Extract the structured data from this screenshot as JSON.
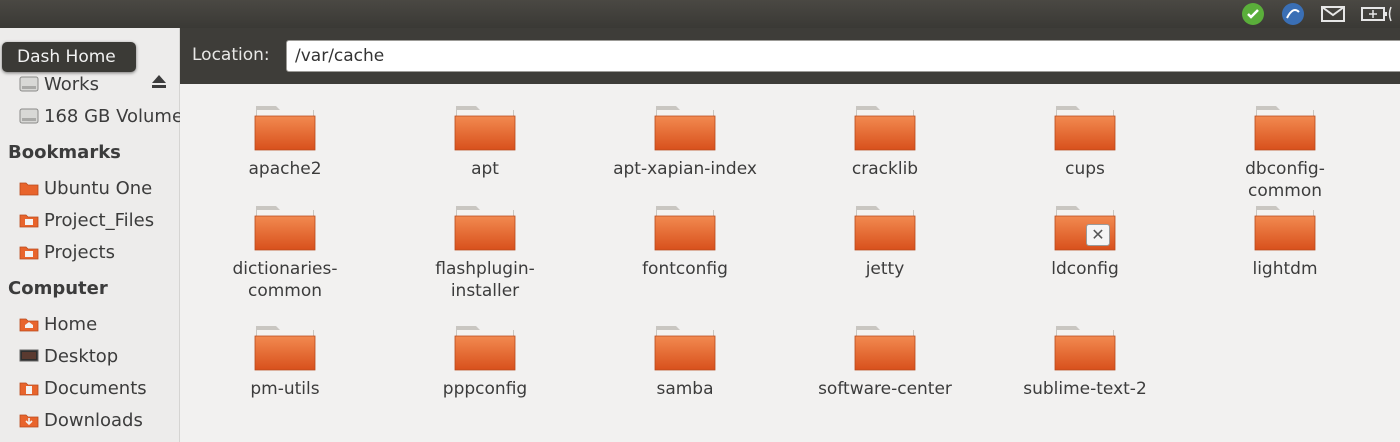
{
  "sidebar": {
    "tooltip": "Dash Home",
    "devices": [
      {
        "label": "Works",
        "icon": "drive-icon"
      },
      {
        "label": "168 GB Volume",
        "icon": "drive-icon"
      }
    ],
    "bookmarks_heading": "Bookmarks",
    "bookmarks": [
      {
        "label": "Ubuntu One",
        "icon": "folder-icon"
      },
      {
        "label": "Project_Files",
        "icon": "folder-icon"
      },
      {
        "label": "Projects",
        "icon": "folder-icon"
      }
    ],
    "computer_heading": "Computer",
    "computer": [
      {
        "label": "Home",
        "icon": "home-folder-icon"
      },
      {
        "label": "Desktop",
        "icon": "desktop-icon"
      },
      {
        "label": "Documents",
        "icon": "documents-icon"
      },
      {
        "label": "Downloads",
        "icon": "downloads-icon"
      }
    ]
  },
  "location": {
    "label": "Location:",
    "value": "/var/cache"
  },
  "folders": [
    {
      "name": "apache2"
    },
    {
      "name": "apt"
    },
    {
      "name": "apt-xapian-index"
    },
    {
      "name": "cracklib"
    },
    {
      "name": "cups"
    },
    {
      "name": "dbconfig-common"
    },
    {
      "name": "dictionaries-common"
    },
    {
      "name": "flashplugin-installer"
    },
    {
      "name": "fontconfig"
    },
    {
      "name": "jetty"
    },
    {
      "name": "ldconfig",
      "locked": true
    },
    {
      "name": "lightdm"
    },
    {
      "name": "pm-utils"
    },
    {
      "name": "pppconfig"
    },
    {
      "name": "samba"
    },
    {
      "name": "software-center"
    },
    {
      "name": "sublime-text-2"
    }
  ],
  "colors": {
    "folder_orange": "#e8642c",
    "panel_dark": "#3e3d39"
  }
}
